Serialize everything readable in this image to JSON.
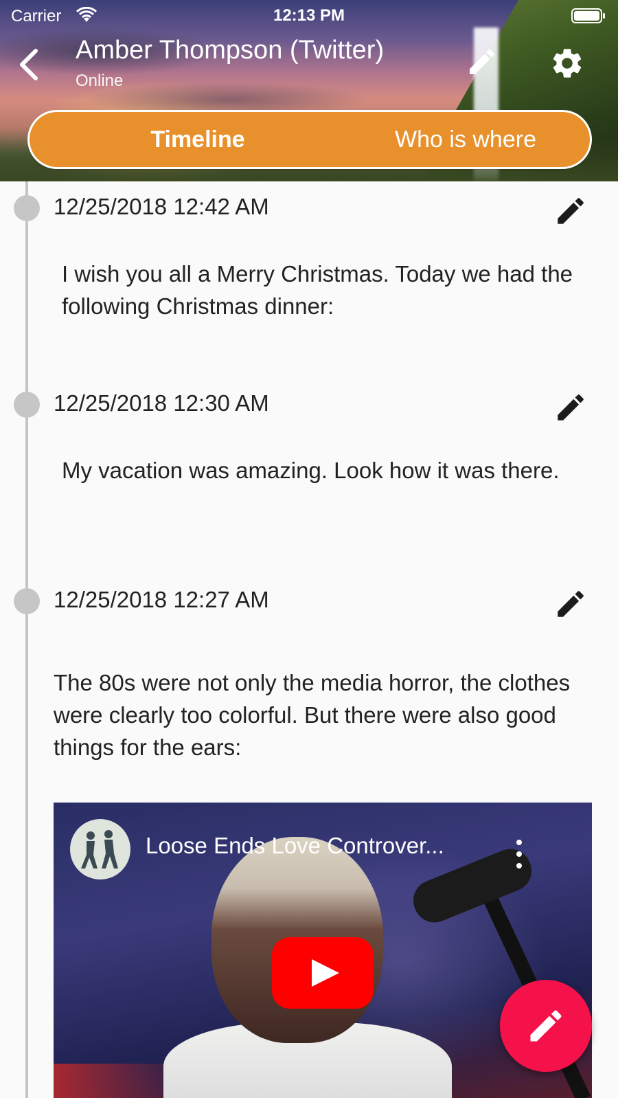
{
  "status_bar": {
    "carrier": "Carrier",
    "time": "12:13 PM",
    "wifi_icon": "wifi-icon",
    "battery_icon": "battery-icon"
  },
  "header": {
    "title": "Amber Thompson (Twitter)",
    "subtitle": "Online",
    "back_icon": "chevron-left-icon",
    "edit_icon": "pencil-icon",
    "settings_icon": "gear-icon"
  },
  "tabs": [
    {
      "label": "Timeline",
      "active": true
    },
    {
      "label": "Who is where",
      "active": false
    }
  ],
  "colors": {
    "segment_bg": "#e8912c",
    "fab_bg": "#f5124a",
    "timeline_line": "#c4c4c4",
    "youtube_red": "#ff0000"
  },
  "entries": [
    {
      "timestamp": "12/25/2018 12:42 AM",
      "text": "I wish you all a Merry Christmas. Today we had the following Christmas dinner:"
    },
    {
      "timestamp": "12/25/2018 12:30 AM",
      "text": "My vacation was amazing. Look how it was there."
    },
    {
      "timestamp": "12/25/2018 12:27 AM",
      "text": "The 80s were not only the media horror, the clothes were clearly too colorful. But there were also good things for the ears:",
      "video": {
        "title": "Loose Ends Love Controver...",
        "play_icon": "youtube-play-icon",
        "more_icon": "more-vertical-icon"
      }
    }
  ],
  "fab": {
    "icon": "pencil-icon"
  }
}
